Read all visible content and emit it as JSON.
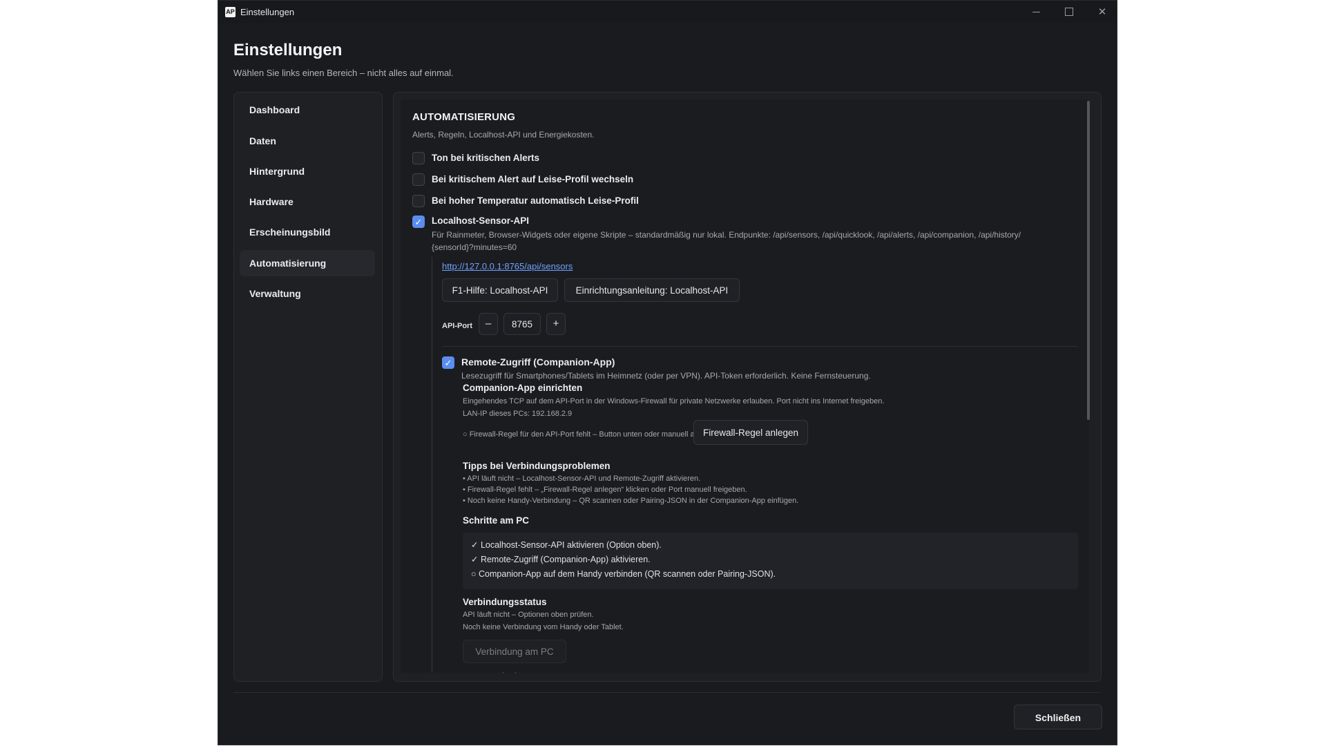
{
  "window": {
    "title": "Einstellungen",
    "app_icon": "AP"
  },
  "header": {
    "title": "Einstellungen",
    "subtitle": "Wählen Sie links einen Bereich – nicht alles auf einmal."
  },
  "sidebar": {
    "items": [
      {
        "label": "Dashboard"
      },
      {
        "label": "Daten"
      },
      {
        "label": "Hintergrund"
      },
      {
        "label": "Hardware"
      },
      {
        "label": "Erscheinungsbild"
      },
      {
        "label": "Automatisierung",
        "active": true
      },
      {
        "label": "Verwaltung"
      }
    ]
  },
  "section": {
    "title": "AUTOMATISIERUNG",
    "subtitle": "Alerts, Regeln, Localhost-API und Energiekosten."
  },
  "options": {
    "sound_alerts": {
      "label": "Ton bei kritischen Alerts",
      "checked": false
    },
    "quiet_on_alert": {
      "label": "Bei kritischem Alert auf Leise-Profil wechseln",
      "checked": false
    },
    "quiet_on_temp": {
      "label": "Bei hoher Temperatur automatisch Leise-Profil",
      "checked": false
    },
    "localhost_api": {
      "label": "Localhost-Sensor-API",
      "checked": true,
      "description_line1": "Für Rainmeter, Browser-Widgets oder eigene Skripte – standardmäßig nur lokal. Endpunkte: /api/sensors, /api/quicklook, /api/alerts, /api/companion, /api/history/",
      "description_line2": "{sensorId}?minutes=60",
      "url": "http://127.0.0.1:8765/api/sensors",
      "help_button": "F1-Hilfe: Localhost-API",
      "guide_button": "Einrichtungsanleitung: Localhost-API",
      "port_label": "API-Port",
      "port_value": "8765",
      "decrement": "–",
      "increment": "+"
    },
    "remote_access": {
      "label": "Remote-Zugriff (Companion-App)",
      "checked": true,
      "description": "Lesezugriff für Smartphones/Tablets im Heimnetz (oder per VPN). API-Token erforderlich. Keine Fernsteuerung."
    }
  },
  "companion": {
    "setup_title": "Companion-App einrichten",
    "setup_text": "Eingehendes TCP auf dem API-Port in der Windows-Firewall für private Netzwerke erlauben. Port nicht ins Internet freigeben.",
    "lan_ip": "LAN-IP dieses PCs: 192.168.2.9",
    "firewall_status": "○ Firewall-Regel für den API-Port fehlt – Button unten oder manuell anlegen",
    "firewall_button": "Firewall-Regel anlegen",
    "tips_title": "Tipps bei Verbindungsproblemen",
    "tips": [
      "• API läuft nicht – Localhost-Sensor-API und Remote-Zugriff aktivieren.",
      "• Firewall-Regel fehlt – „Firewall-Regel anlegen“ klicken oder Port manuell freigeben.",
      "• Noch keine Handy-Verbindung – QR scannen oder Pairing-JSON in der Companion-App einfügen."
    ],
    "steps_title": "Schritte am PC",
    "steps": [
      "✓ Localhost-Sensor-API aktivieren (Option oben).",
      "✓ Remote-Zugriff (Companion-App) aktivieren.",
      "○ Companion-App auf dem Handy verbinden (QR scannen oder Pairing-JSON)."
    ],
    "status_title": "Verbindungsstatus",
    "status_line1": "API läuft nicht – Optionen oben prüfen.",
    "status_line2": "Noch keine Verbindung vom Handy oder Tablet.",
    "test_button": "Verbindung am PC testen"
  },
  "footer": {
    "close_button": "Schließen"
  },
  "colors": {
    "accent": "#5b8def",
    "link": "#6ea2ff",
    "window_bg": "#1a1b1f",
    "panel_bg": "#1f2024"
  },
  "icons": {
    "minimize": "minimize-icon",
    "maximize": "maximize-icon",
    "close": "close-icon",
    "check": "checkmark-icon"
  }
}
